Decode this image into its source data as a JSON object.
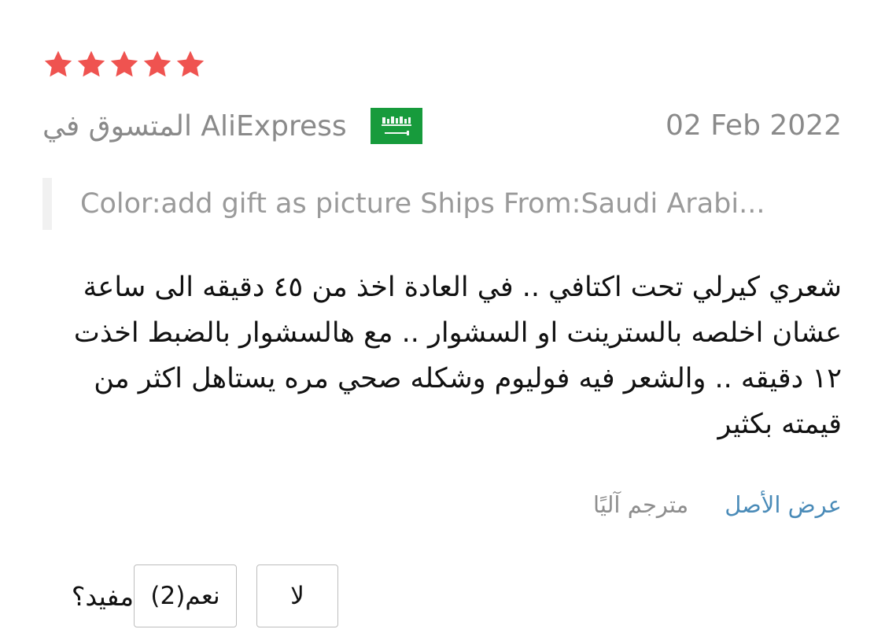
{
  "review": {
    "rating": 5,
    "rating_max": 5,
    "star_color": "#ef5350",
    "reviewer_label": "AliExpress المتسوق في",
    "country_flag_icon": "saudi-arabia-flag-icon",
    "date": "02 Feb 2022",
    "sku": "Color:add gift as picture Ships From:Saudi Arabi...",
    "text": "شعري كيرلي تحت اكتافي .. في العادة اخذ من ٤٥ دقيقه الى ساعة عشان اخلصه بالسترينت او السشوار .. مع هالسشوار بالضبط اخذت ١٢ دقيقه .. والشعر فيه فوليوم وشكله صحي مره  يستاهل اكثر من قيمته بكثير",
    "show_original_label": "عرض الأصل",
    "machine_translated_label": "مترجم آليًا",
    "helpful_label": "مفيد؟",
    "helpful_yes_label": "نعم(2)",
    "helpful_no_label": "لا"
  }
}
